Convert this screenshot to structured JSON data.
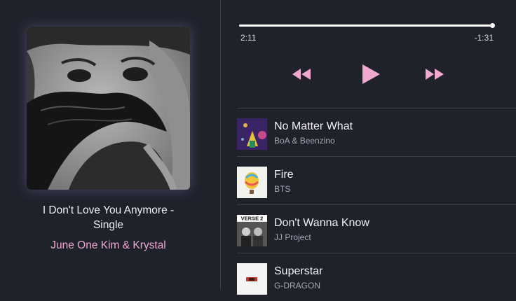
{
  "now_playing": {
    "album_title": "I Don't Love You Anymore - Single",
    "album_artist": "June One Kim & Krystal"
  },
  "playback": {
    "elapsed": "2:11",
    "remaining": "-1:31",
    "progress_fraction": 0.99
  },
  "controls": {
    "rewind_icon": "rewind-icon",
    "play_icon": "play-icon",
    "forward_icon": "fast-forward-icon"
  },
  "tracks": [
    {
      "title": "No Matter What",
      "artist": "BoA & Beenzino"
    },
    {
      "title": "Fire",
      "artist": "BTS"
    },
    {
      "title": "Don't Wanna Know",
      "artist": "JJ Project",
      "art_text": "VERSE 2"
    },
    {
      "title": "Superstar",
      "artist": "G-DRAGON"
    }
  ],
  "colors": {
    "background": "#1f212b",
    "accent_pink": "#f1a8d0",
    "divider": "#3a3c48"
  }
}
